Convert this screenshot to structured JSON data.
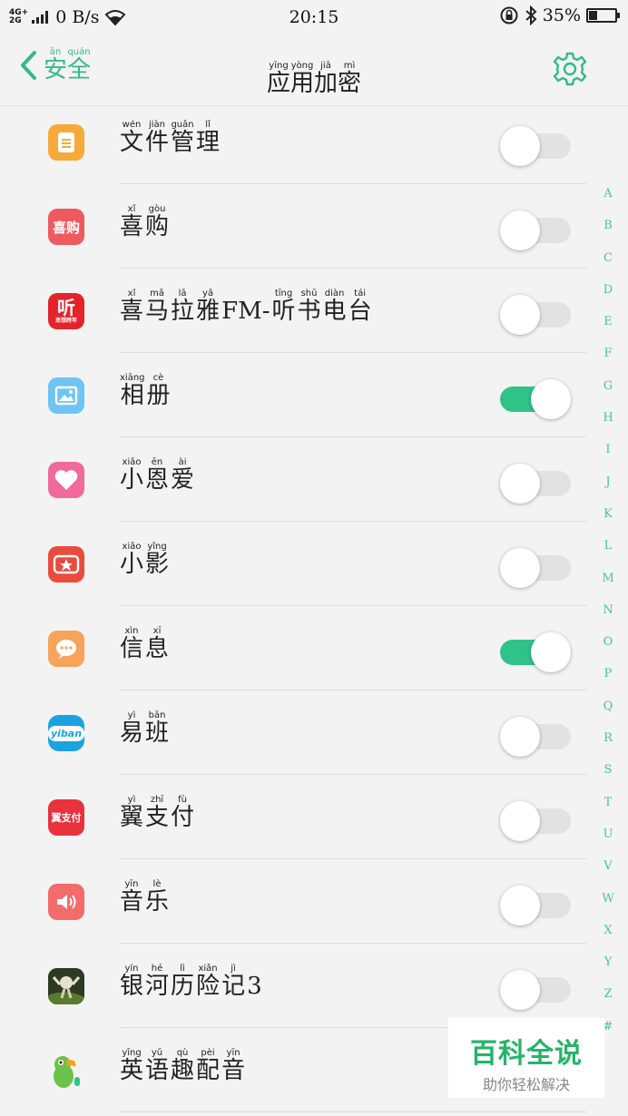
{
  "status_bar": {
    "network_top": "4G+",
    "network_bottom": "2G",
    "speed": "0 B/s",
    "time": "20:15",
    "battery": "35%",
    "battery_level": 0.35,
    "icons": [
      "signal-icon",
      "wifi-icon",
      "lock-rotation-icon",
      "bluetooth-icon",
      "battery-icon"
    ]
  },
  "header": {
    "back": [
      {
        "py": "ān",
        "hz": "安"
      },
      {
        "py": "quán",
        "hz": "全"
      }
    ],
    "title": [
      {
        "py": "yīng",
        "hz": "应"
      },
      {
        "py": "yòng",
        "hz": "用"
      },
      {
        "py": "jiā",
        "hz": "加"
      },
      {
        "py": "mì",
        "hz": "密"
      }
    ],
    "settings_icon": "gear-icon"
  },
  "colors": {
    "accent": "#35b98a",
    "toggle_on": "#2fc38a",
    "toggle_off": "#e2e2e2"
  },
  "apps": [
    {
      "name": [
        {
          "py": "wén",
          "hz": "文"
        },
        {
          "py": "jiàn",
          "hz": "件"
        },
        {
          "py": "guǎn",
          "hz": "管"
        },
        {
          "py": "lǐ",
          "hz": "理"
        }
      ],
      "enabled": false,
      "icon": "file-manager-icon"
    },
    {
      "name": [
        {
          "py": "xǐ",
          "hz": "喜"
        },
        {
          "py": "gòu",
          "hz": "购"
        }
      ],
      "enabled": false,
      "icon": "xigou-icon"
    },
    {
      "name": [
        {
          "py": "xǐ",
          "hz": "喜"
        },
        {
          "py": "mǎ",
          "hz": "马"
        },
        {
          "py": "lā",
          "hz": "拉"
        },
        {
          "py": "yǎ",
          "hz": "雅"
        },
        {
          "py": "",
          "hz": "FM-"
        },
        {
          "py": "tīng",
          "hz": "听"
        },
        {
          "py": "shū",
          "hz": "书"
        },
        {
          "py": "diàn",
          "hz": "电"
        },
        {
          "py": "tái",
          "hz": "台"
        }
      ],
      "enabled": false,
      "icon": "ximalaya-icon"
    },
    {
      "name": [
        {
          "py": "xiāng",
          "hz": "相"
        },
        {
          "py": "cè",
          "hz": "册"
        }
      ],
      "enabled": true,
      "icon": "photos-icon"
    },
    {
      "name": [
        {
          "py": "xiǎo",
          "hz": "小"
        },
        {
          "py": "ēn",
          "hz": "恩"
        },
        {
          "py": "ài",
          "hz": "爱"
        }
      ],
      "enabled": false,
      "icon": "heart-icon"
    },
    {
      "name": [
        {
          "py": "xiǎo",
          "hz": "小"
        },
        {
          "py": "yǐng",
          "hz": "影"
        }
      ],
      "enabled": false,
      "icon": "xiaoying-icon"
    },
    {
      "name": [
        {
          "py": "xìn",
          "hz": "信"
        },
        {
          "py": "xī",
          "hz": "息"
        }
      ],
      "enabled": true,
      "icon": "messages-icon"
    },
    {
      "name": [
        {
          "py": "yì",
          "hz": "易"
        },
        {
          "py": "bān",
          "hz": "班"
        }
      ],
      "enabled": false,
      "icon": "yiban-icon"
    },
    {
      "name": [
        {
          "py": "yì",
          "hz": "翼"
        },
        {
          "py": "zhī",
          "hz": "支"
        },
        {
          "py": "fù",
          "hz": "付"
        }
      ],
      "enabled": false,
      "icon": "bestpay-icon"
    },
    {
      "name": [
        {
          "py": "yīn",
          "hz": "音"
        },
        {
          "py": "lè",
          "hz": "乐"
        }
      ],
      "enabled": false,
      "icon": "music-icon"
    },
    {
      "name": [
        {
          "py": "yín",
          "hz": "银"
        },
        {
          "py": "hé",
          "hz": "河"
        },
        {
          "py": "lì",
          "hz": "历"
        },
        {
          "py": "xiǎn",
          "hz": "险"
        },
        {
          "py": "jì",
          "hz": "记"
        },
        {
          "py": "",
          "hz": "3"
        }
      ],
      "enabled": false,
      "icon": "game-icon"
    },
    {
      "name": [
        {
          "py": "yīng",
          "hz": "英"
        },
        {
          "py": "yǔ",
          "hz": "语"
        },
        {
          "py": "qù",
          "hz": "趣"
        },
        {
          "py": "pèi",
          "hz": "配"
        },
        {
          "py": "yīn",
          "hz": "音"
        }
      ],
      "enabled": false,
      "icon": "parrot-icon"
    }
  ],
  "alpha_index": [
    "A",
    "B",
    "C",
    "D",
    "E",
    "F",
    "G",
    "H",
    "I",
    "J",
    "K",
    "L",
    "M",
    "N",
    "O",
    "P",
    "Q",
    "R",
    "S",
    "T",
    "U",
    "V",
    "W",
    "X",
    "Y",
    "Z",
    "#"
  ],
  "watermark": {
    "title": "百科全说",
    "subtitle": "助你轻松解决"
  },
  "icon_texts": {
    "xigou": "喜购",
    "ximalaya": "听",
    "ximalaya_sub": "思想跨年",
    "yiban": "yiban",
    "bestpay": "翼支付"
  }
}
